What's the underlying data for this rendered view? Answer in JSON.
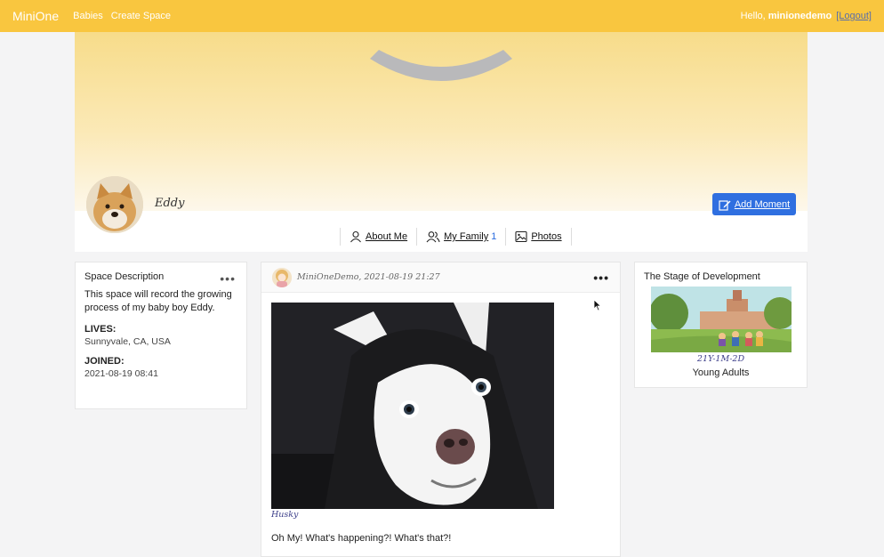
{
  "nav": {
    "brand": "MiniOne",
    "links": [
      "Babies",
      "Create Space"
    ],
    "greeting": "Hello,",
    "username": "minionedemo",
    "logout": "[Logout]"
  },
  "profile": {
    "name": "Eddy",
    "add_moment": "Add Moment",
    "tabs": {
      "about": "About Me",
      "family": "My Family",
      "family_count": "1",
      "photos": "Photos"
    }
  },
  "space": {
    "title": "Space Description",
    "description": "This space will record the growing process of my baby boy Eddy.",
    "lives_label": "LIVES:",
    "lives_value": "Sunnyvale, CA, USA",
    "joined_label": "JOINED:",
    "joined_value": "2021-08-19 08:41"
  },
  "post": {
    "meta": "MiniOneDemo, 2021-08-19 21:27",
    "caption": "Husky",
    "text": "Oh My! What's happening?! What's that?!"
  },
  "stage": {
    "title": "The Stage of Development",
    "age": "21Y-1M-2D",
    "name": "Young Adults"
  },
  "colors": {
    "navbar": "#f9c63f",
    "primary_button": "#2f6fe0",
    "accent_text": "#3d3f8a"
  },
  "icons": [
    "edit-icon",
    "user-icon",
    "users-icon",
    "image-icon",
    "more-icon",
    "cursor-icon"
  ]
}
